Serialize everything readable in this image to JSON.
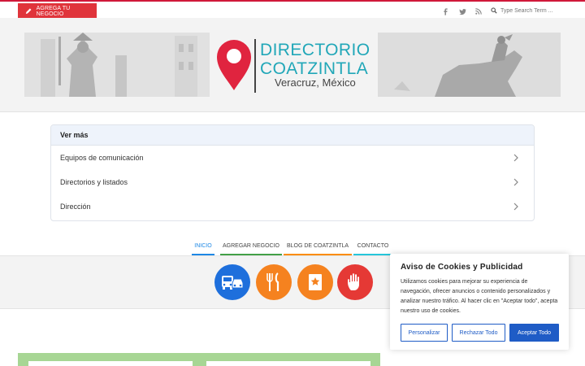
{
  "topbar": {
    "add_business_label": "AGREGA TU NEGOCIO",
    "social_icons": [
      "facebook-icon",
      "twitter-icon",
      "rss-icon"
    ],
    "search_placeholder": "Type Search Term ...",
    "accent_color": "#e0343b"
  },
  "header": {
    "logo_line1": "DIRECTORIO",
    "logo_line2": "COATZINTLA",
    "logo_subtitle": "Veracruz, México",
    "brand_color": "#21a7b8",
    "pin_color": "#e0243f"
  },
  "card": {
    "heading": "Ver más",
    "items": [
      {
        "label": "Equipos de comunicación"
      },
      {
        "label": "Directorios y listados"
      },
      {
        "label": "Dirección"
      }
    ]
  },
  "nav": {
    "items": [
      {
        "label": "INICIO",
        "color": "#1e88e5",
        "active": true
      },
      {
        "label": "AGREGAR NEGOCIO",
        "color": "#43a047"
      },
      {
        "label": "BLOG DE COATZINTLA",
        "color": "#fb8c00"
      },
      {
        "label": "CONTACTO",
        "color": "#26c6da"
      }
    ]
  },
  "categories": [
    {
      "icon": "bus-car-icon",
      "color": "#1e6fdc"
    },
    {
      "icon": "restaurant-icon",
      "color": "#f5821f"
    },
    {
      "icon": "bookmark-star-icon",
      "color": "#f5821f"
    },
    {
      "icon": "hand-stop-icon",
      "color": "#e53935"
    }
  ],
  "cookie": {
    "title": "Aviso de Cookies y Publicidad",
    "text": "Utilizamos cookies para mejorar su experiencia de navegación, ofrecer anuncios o contenido personalizados y analizar nuestro tráfico. Al hacer clic en \"Aceptar todo\", acepta nuestro uso de cookies.",
    "customize_label": "Personalizar",
    "reject_label": "Rechazar Todo",
    "accept_label": "Aceptar Todo",
    "button_color": "#1f5cc6"
  }
}
